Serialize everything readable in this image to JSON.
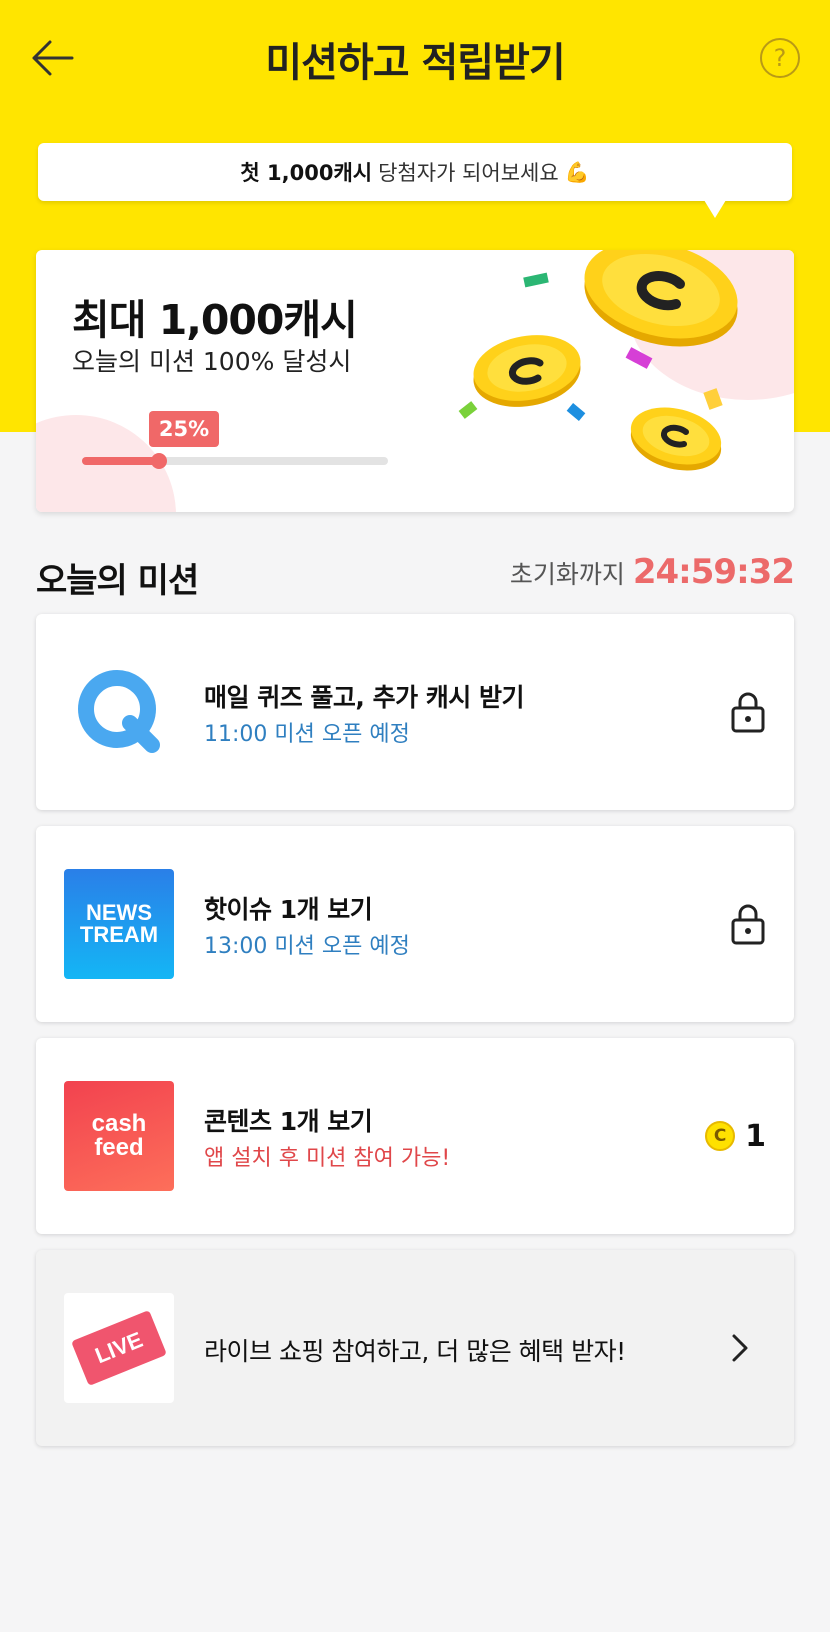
{
  "header": {
    "title": "미션하고 적립받기",
    "back_icon": "arrow-left-icon",
    "help_label": "?"
  },
  "bubble": {
    "bold_text": "첫 1,000캐시",
    "text": "당첨자가 되어보세요",
    "emoji": "💪"
  },
  "hero": {
    "title": "최대 1,000캐시",
    "subtitle": "오늘의 미션 100% 달성시",
    "progress_label": "25%",
    "progress_fraction": 0.25
  },
  "section": {
    "title": "오늘의 미션",
    "reset_label": "초기화까지",
    "reset_timer": "24:59:32"
  },
  "missions": [
    {
      "icon": "quiz-q-icon",
      "title": "매일 퀴즈 풀고, 추가 캐시 받기",
      "subtitle": "11:00 미션 오픈 예정",
      "right": "lock-icon"
    },
    {
      "icon": "newstream-logo",
      "logo_line1": "NEWS",
      "logo_line2": "TREAM",
      "title": "핫이슈 1개 보기",
      "subtitle": "13:00 미션 오픈 예정",
      "right": "lock-icon"
    },
    {
      "icon": "cashfeed-logo",
      "logo_line1": "cash",
      "logo_line2": "feed",
      "title": "콘텐츠 1개 보기",
      "subtitle": "앱 설치 후 미션 참여 가능!",
      "reward_coin": "C",
      "reward_value": "1"
    },
    {
      "icon": "live-ticket-logo",
      "logo_text": "LIVE",
      "title": "라이브 쇼핑 참여하고, 더 많은 혜택 받자!",
      "right": "chevron-right-icon"
    }
  ],
  "colors": {
    "brand_yellow": "#ffe500",
    "accent_red": "#f06868",
    "link_blue": "#2f7fc0",
    "warn_red": "#e0474a"
  }
}
